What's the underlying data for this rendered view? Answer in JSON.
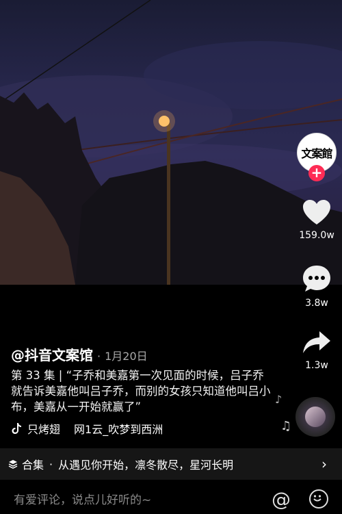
{
  "author": {
    "handle": "@抖音文案馆",
    "date": "1月20日"
  },
  "avatar": {
    "text": "文案館"
  },
  "actions": {
    "likes": "159.0w",
    "comments": "3.8w",
    "shares": "1.3w"
  },
  "description": {
    "episode": "第 33 集",
    "text": "“子乔和美嘉第一次见面的时候，吕子乔就告诉美嘉他叫吕子乔，而别的女孩只知道他叫吕小布，美嘉从一开始就赢了”"
  },
  "music": {
    "track1": "只烤翅",
    "track2": "网1云_吹梦到西洲"
  },
  "collection": {
    "label": "合集",
    "title": "从遇见你开始，凛冬散尽，星河长明"
  },
  "comment_bar": {
    "placeholder": "有爱评论，说点儿好听的~"
  },
  "colors": {
    "accent": "#fe2c55"
  }
}
